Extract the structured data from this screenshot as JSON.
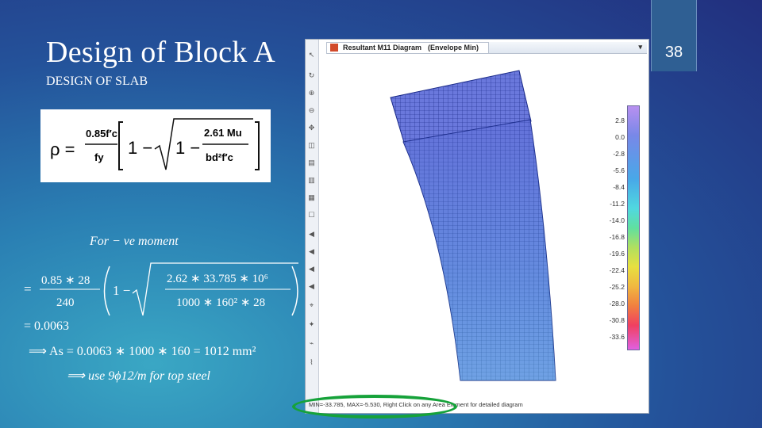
{
  "slide": {
    "title": "Design of Block A",
    "subtitle": "DESIGN OF SLAB",
    "page_number": "38"
  },
  "formula": {
    "lhs": "ρ =",
    "frac1_num": "0.85f′c",
    "frac1_den": "fy",
    "inner_num": "2.61 Mu",
    "inner_den": "bd²f′c"
  },
  "calc": {
    "heading": "For  − ve moment",
    "line1_a_num": "0.85 ∗ 28",
    "line1_a_den": "240",
    "line1_b_num": "2.62 ∗ 33.785 ∗ 10⁶",
    "line1_b_den": "1000 ∗ 160² ∗ 28",
    "line2": "= 0.0063",
    "line3": "⟹ As = 0.0063 ∗ 1000 ∗ 160 = 1012 mm²",
    "line4": "⟹ use 9ϕ12/m  for  top steel"
  },
  "window": {
    "tab_title": "Resultant M11 Diagram",
    "tab_subtitle": "(Envelope  Min)",
    "status": "MIN=-33.785, MAX=-5.530, Right Click on any Area Element for detailed diagram"
  },
  "scale_labels": [
    "2.8",
    "0.0",
    "-2.8",
    "-5.6",
    "-8.4",
    "-11.2",
    "-14.0",
    "-16.8",
    "-19.6",
    "-22.4",
    "-25.2",
    "-28.0",
    "-30.8",
    "-33.6"
  ],
  "colors": {
    "highlight": "#16a23a",
    "mesh_fill": "#5b6fd8",
    "mesh_line": "#1a2a88"
  }
}
